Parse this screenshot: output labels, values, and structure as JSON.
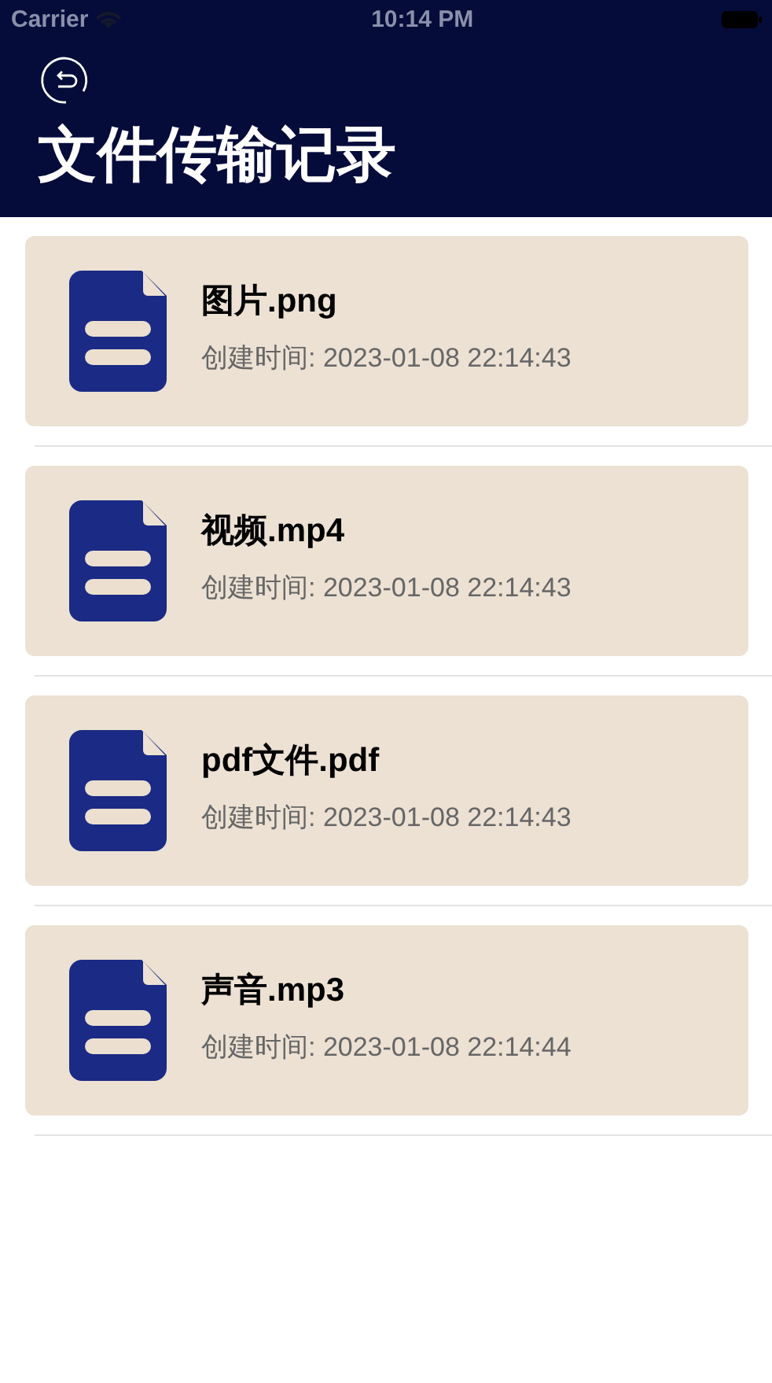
{
  "status_bar": {
    "carrier": "Carrier",
    "time": "10:14 PM"
  },
  "header": {
    "title": "文件传输记录"
  },
  "files": [
    {
      "name": "图片.png",
      "created": "创建时间: 2023-01-08 22:14:43"
    },
    {
      "name": "视频.mp4",
      "created": "创建时间: 2023-01-08 22:14:43"
    },
    {
      "name": "pdf文件.pdf",
      "created": "创建时间: 2023-01-08 22:14:43"
    },
    {
      "name": "声音.mp3",
      "created": "创建时间: 2023-01-08 22:14:44"
    }
  ]
}
